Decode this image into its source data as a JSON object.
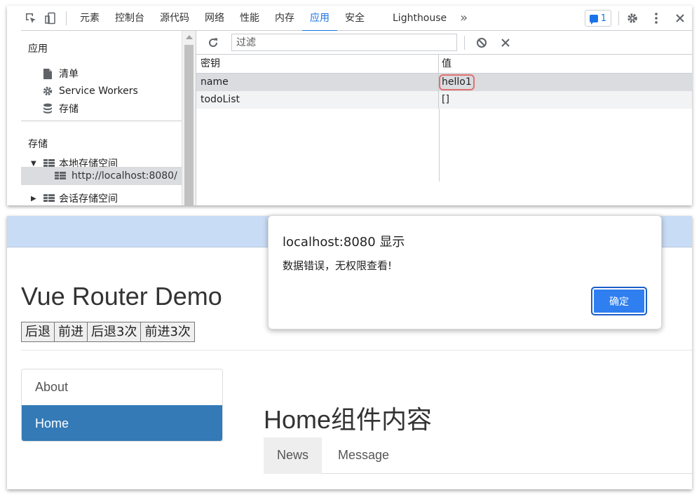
{
  "devtools": {
    "tabs": [
      "元素",
      "控制台",
      "源代码",
      "网络",
      "性能",
      "内存",
      "应用",
      "安全",
      "Lighthouse"
    ],
    "active_tab": "应用",
    "more_tabs_glyph": "»",
    "issues_count": "1",
    "sidebar": {
      "app_heading": "应用",
      "app_items": [
        {
          "label": "清单",
          "icon": "file-icon"
        },
        {
          "label": "Service Workers",
          "icon": "gear-icon"
        },
        {
          "label": "存储",
          "icon": "database-icon"
        }
      ],
      "storage_heading": "存储",
      "local_storage_label": "本地存储空间",
      "local_storage_origin": "http://localhost:8080/",
      "session_storage_label": "会话存储空间"
    },
    "filter": {
      "placeholder": "过滤"
    },
    "table": {
      "columns": {
        "key": "密钥",
        "value": "值"
      },
      "rows": [
        {
          "key": "name",
          "value": "hello1"
        },
        {
          "key": "todoList",
          "value": "[]"
        }
      ]
    }
  },
  "page": {
    "title": "Vue Router Demo",
    "nav_buttons": [
      "后退",
      "前进",
      "后退3次",
      "前进3次"
    ],
    "sidebar_links": [
      {
        "label": "About",
        "active": false
      },
      {
        "label": "Home",
        "active": true
      }
    ],
    "home_heading": "Home组件内容",
    "home_tabs": [
      {
        "label": "News",
        "active": true
      },
      {
        "label": "Message",
        "active": false
      }
    ]
  },
  "dialog": {
    "title": "localhost:8080 显示",
    "message": "数据错误，无权限查看!",
    "ok_label": "确定"
  },
  "colors": {
    "devtools_accent": "#1a73e8",
    "active_list_item": "#337ab7",
    "dialog_button": "#2f7ff0",
    "page_top_band": "#c9dcf5",
    "value_highlight": "#e07070"
  }
}
